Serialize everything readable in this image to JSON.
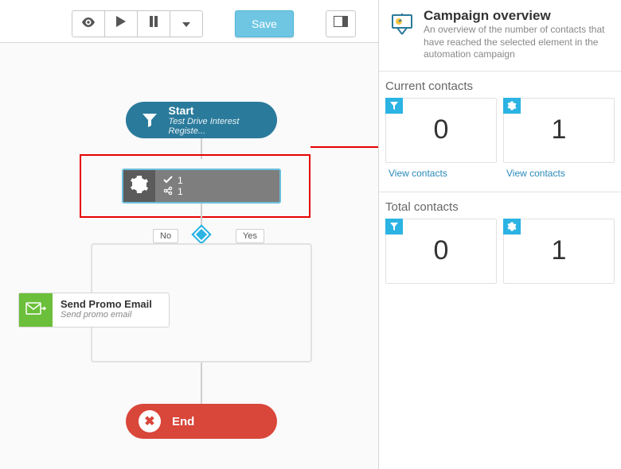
{
  "toolbar": {
    "save_label": "Save"
  },
  "nodes": {
    "start": {
      "title": "Start",
      "subtitle": "Test Drive Interest Registe..."
    },
    "gear": {
      "check_count": "1",
      "share_count": "1"
    },
    "decision": {
      "no_label": "No",
      "yes_label": "Yes"
    },
    "email": {
      "title": "Send Promo Email",
      "subtitle": "Send promo email"
    },
    "end": {
      "label": "End"
    }
  },
  "panel": {
    "title": "Campaign overview",
    "description": "An overview of the number of contacts that have reached the selected element in the automation campaign",
    "current": {
      "heading": "Current contacts",
      "cards": [
        {
          "kind": "filter",
          "value": "0",
          "link": "View contacts"
        },
        {
          "kind": "gear",
          "value": "1",
          "link": "View contacts"
        }
      ]
    },
    "total": {
      "heading": "Total contacts",
      "cards": [
        {
          "kind": "filter",
          "value": "0"
        },
        {
          "kind": "gear",
          "value": "1"
        }
      ]
    }
  }
}
